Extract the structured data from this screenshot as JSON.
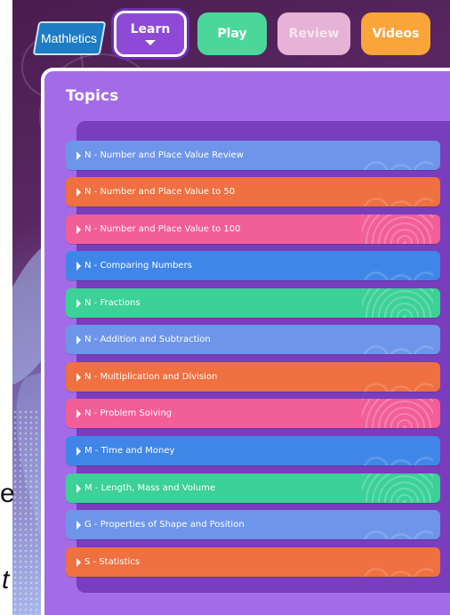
{
  "header": {
    "logo_text": "Mathletics",
    "tabs": [
      {
        "label": "Learn",
        "active": true,
        "color": "#8e49d6"
      },
      {
        "label": "Play",
        "color": "#4bd79a"
      },
      {
        "label": "Review",
        "color": "#e6b3d6"
      },
      {
        "label": "Videos",
        "color": "#f9a53a"
      }
    ]
  },
  "edge_text": {
    "top": "e",
    "bottom": "t"
  },
  "panel": {
    "title": "Topics",
    "topics": [
      {
        "label": "N - Number and Place Value Review",
        "color": "#6d95ea"
      },
      {
        "label": "N - Number and Place Value to 50",
        "color": "#ef7040"
      },
      {
        "label": "N - Number and Place Value to 100",
        "color": "#f25e97"
      },
      {
        "label": "N - Comparing Numbers",
        "color": "#3f86e8"
      },
      {
        "label": "N - Fractions",
        "color": "#3cd196"
      },
      {
        "label": "N - Addition and Subtraction",
        "color": "#6d95ea"
      },
      {
        "label": "N - Multiplication and Division",
        "color": "#ef7040"
      },
      {
        "label": "N - Problem Solving",
        "color": "#f25e97"
      },
      {
        "label": "M - Time and Money",
        "color": "#3f86e8"
      },
      {
        "label": "M - Length, Mass and Volume",
        "color": "#3cd196"
      },
      {
        "label": "G - Properties of Shape and Position",
        "color": "#6d95ea"
      },
      {
        "label": "S - Statistics",
        "color": "#ef7040"
      }
    ]
  }
}
